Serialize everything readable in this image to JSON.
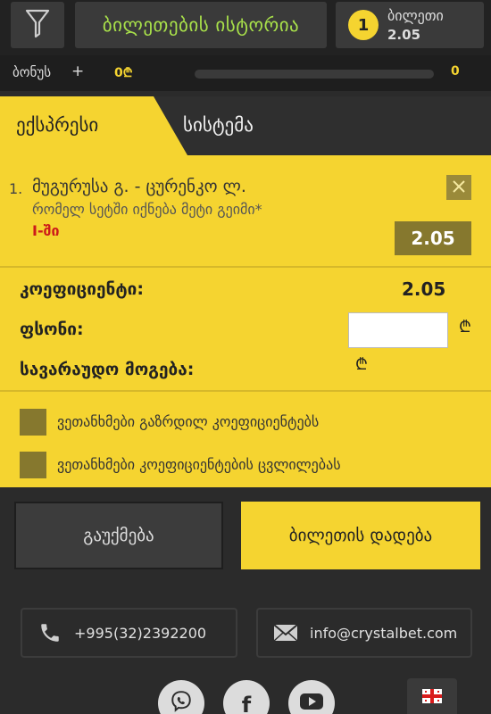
{
  "header": {
    "history_label": "ბილეთების ისტორია",
    "ticket_count": "1",
    "ticket_label": "ბილეთი",
    "ticket_value": "2.05"
  },
  "bonus": {
    "label": "ბონუს",
    "plus": "+",
    "amount": "0₾",
    "max": "0",
    "progress_fraction": 0
  },
  "tabs": {
    "express": "ექსპრესი",
    "system": "სისტემა"
  },
  "bet": {
    "number": "1.",
    "event": "მუგურუსა გ. - ცურენკო ლ.",
    "market": "რომელ სეტში იქნება მეტი გეიმი*",
    "outcome": "I-ში",
    "odds": "2.05"
  },
  "summary": {
    "coefficient_label": "კოეფიციენტი:",
    "coefficient_value": "2.05",
    "stake_label": "ფსონი:",
    "stake_value": "",
    "currency_symbol": "₾",
    "potential_win_label": "სავარაუდო მოგება:"
  },
  "options": {
    "accept_increased": "ვეთანხმები გაზრდილ კოეფიციენტებს",
    "accept_changes": "ვეთანხმები კოეფიციენტების ცვლილებას"
  },
  "actions": {
    "clear": "გაუქმება",
    "place_bet": "ბილეთის დადება"
  },
  "contacts": {
    "phone": "+995(32)2392200",
    "email": "info@crystalbet.com"
  },
  "social": {
    "facebook_glyph": "f",
    "icons": [
      "viber-icon",
      "facebook-icon",
      "youtube-icon",
      "georgian-flag-icon"
    ]
  },
  "colors": {
    "accent_yellow": "#f5d430",
    "dark_bg": "#2b2b2b",
    "history_green": "#a8e04a",
    "outcome_red": "#cc1a1a"
  }
}
